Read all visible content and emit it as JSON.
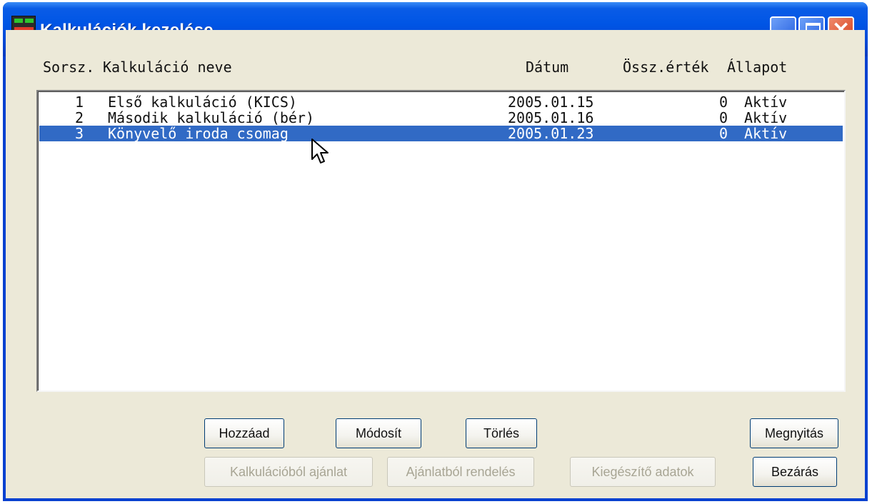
{
  "window": {
    "title": "Kalkulációk kezelése"
  },
  "columns": {
    "sorsz": "Sorsz.",
    "name": "Kalkuláció neve",
    "date": "Dátum",
    "value": "Össz.érték",
    "status": "Állapot"
  },
  "rows": [
    {
      "num": "1",
      "name": "Első kalkuláció (KICS)",
      "date": "2005.01.15",
      "value": "0",
      "status": "Aktív",
      "selected": false
    },
    {
      "num": "2",
      "name": "Második kalkuláció (bér)",
      "date": "2005.01.16",
      "value": "0",
      "status": "Aktív",
      "selected": false
    },
    {
      "num": "3",
      "name": "Könyvelő iroda csomag",
      "date": "2005.01.23",
      "value": "0",
      "status": "Aktív",
      "selected": true
    }
  ],
  "buttons": {
    "add": "Hozzáad",
    "modify": "Módosít",
    "delete": "Törlés",
    "open": "Megnyitás",
    "calc_to_offer": "Kalkulációból ajánlat",
    "offer_to_order": "Ajánlatból rendelés",
    "extra_data": "Kiegészítő adatok",
    "close": "Bezárás"
  },
  "colors": {
    "titlebar": "#0055e5",
    "selection": "#316ac5",
    "dialog_face": "#ece9d8",
    "close_button": "#d5411d"
  },
  "icons": [
    "app-icon",
    "minimize-icon",
    "maximize-icon",
    "close-icon",
    "mouse-cursor-icon"
  ]
}
